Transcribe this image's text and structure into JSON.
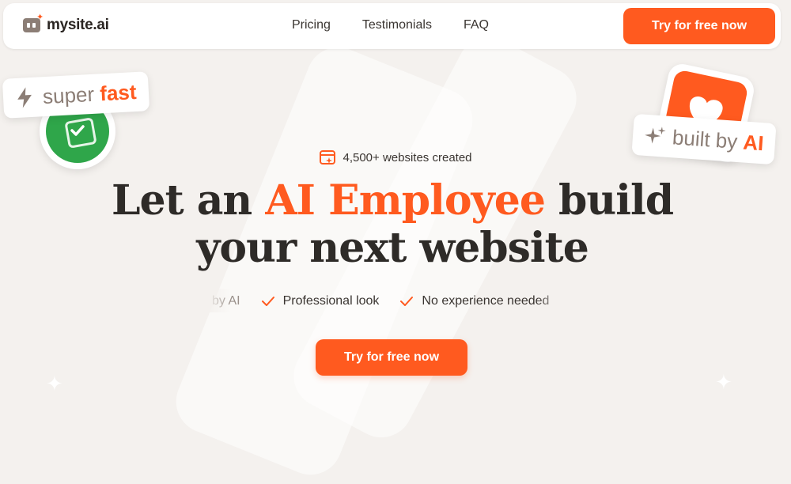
{
  "brand": {
    "name": "mysite.ai",
    "accent_color": "#ff5a1f"
  },
  "nav": {
    "links": [
      "Pricing",
      "Testimonials",
      "FAQ"
    ],
    "cta_label": "Try for free now"
  },
  "badges": {
    "fast": {
      "word1": "super",
      "word2": "fast",
      "icon": "lightning-icon"
    },
    "ai": {
      "word1": "built by",
      "word2": "AI",
      "icon": "sparkles-icon"
    }
  },
  "hero": {
    "counter_text": "4,500+ websites created",
    "headline_line1_pre": "Let an ",
    "headline_accent": "AI Employee",
    "headline_line1_post": " build",
    "headline_line2": "your next website",
    "features": [
      "by AI",
      "Professional look",
      "No experience needed"
    ],
    "cta_label": "Try for free now"
  }
}
